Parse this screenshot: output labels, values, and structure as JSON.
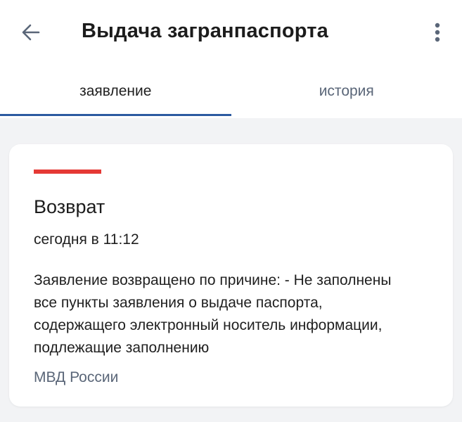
{
  "header": {
    "title": "Выдача загранпаспорта",
    "back_icon": "arrow-left-icon",
    "menu_icon": "more-vertical-icon"
  },
  "tabs": [
    {
      "label": "заявление",
      "active": true
    },
    {
      "label": "история",
      "active": false
    }
  ],
  "card": {
    "status_color": "#e53935",
    "status": "Возврат",
    "time": "сегодня в 11:12",
    "message_lines": [
      "Заявление возвращено по причине: - Не заполнены",
      "все пункты заявления о выдаче паспорта,",
      "содержащего электронный носитель информации,",
      "подлежащие заполнению"
    ],
    "source": "МВД России"
  },
  "colors": {
    "accent": "#2c5aa0",
    "muted_text": "#5a6678",
    "background": "#f2f3f5"
  }
}
